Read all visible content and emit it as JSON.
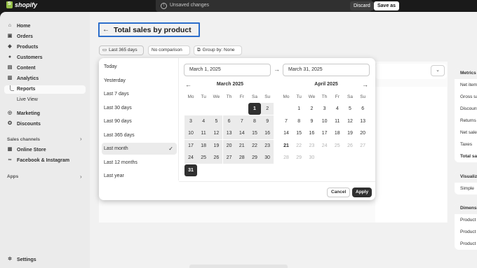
{
  "topbar": {
    "brand": "shopify",
    "unsaved_text": "Unsaved changes",
    "discard_label": "Discard",
    "save_label": "Save as"
  },
  "sidebar": {
    "items": [
      {
        "label": "Home",
        "icon": "home-icon"
      },
      {
        "label": "Orders",
        "icon": "orders-icon"
      },
      {
        "label": "Products",
        "icon": "tag-icon"
      },
      {
        "label": "Customers",
        "icon": "person-icon"
      },
      {
        "label": "Content",
        "icon": "content-icon"
      },
      {
        "label": "Analytics",
        "icon": "analytics-icon"
      }
    ],
    "analytics_sub": [
      "Reports",
      "Live View"
    ],
    "items2": [
      {
        "label": "Marketing",
        "icon": "marketing-icon"
      },
      {
        "label": "Discounts",
        "icon": "discount-icon"
      }
    ],
    "sales_channels_title": "Sales channels",
    "channels": [
      {
        "label": "Online Store",
        "icon": "store-icon"
      },
      {
        "label": "Facebook & Instagram",
        "icon": "meta-icon"
      }
    ],
    "apps_title": "Apps",
    "settings_label": "Settings"
  },
  "page": {
    "title": "Total sales by product",
    "filters": {
      "date": "Last 365 days",
      "comparison": "No comparison",
      "group_by": "Group by: None"
    }
  },
  "right_panel": {
    "metrics_header": "Metrics",
    "metrics": [
      "Net items",
      "Gross sales",
      "Discounts",
      "Returns",
      "Net sales",
      "Taxes",
      "Total sales"
    ],
    "visual_header": "Visualization",
    "visual_value": "Simple",
    "dims_header": "Dimensions",
    "dims": [
      "Product",
      "Product",
      "Product"
    ]
  },
  "datepicker": {
    "presets": [
      "Today",
      "Yesterday",
      "Last 7 days",
      "Last 30 days",
      "Last 90 days",
      "Last 365 days",
      "Last month",
      "Last 12 months",
      "Last year"
    ],
    "selected_preset": "Last month",
    "start_date": "March 1, 2025",
    "end_date": "March 31, 2025",
    "weekdays": [
      "Mo",
      "Tu",
      "We",
      "Th",
      "Fr",
      "Sa",
      "Su"
    ],
    "left_month": {
      "title": "March 2025",
      "first_weekday_index": 5,
      "days": 31,
      "range_start": 1,
      "range_end": 31
    },
    "right_month": {
      "title": "April 2025",
      "first_weekday_index": 1,
      "days": 30,
      "today": 21,
      "disabled_from": 22
    },
    "cancel_label": "Cancel",
    "apply_label": "Apply"
  }
}
